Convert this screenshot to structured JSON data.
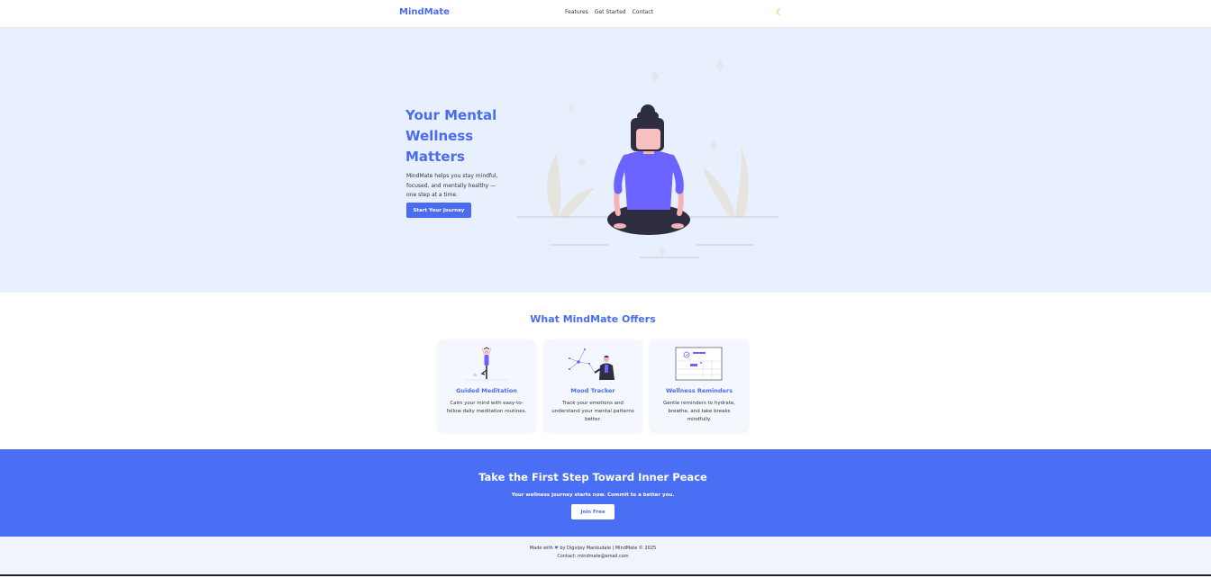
{
  "nav": {
    "logo": "MindMate",
    "links": [
      "Features",
      "Get Started",
      "Contact"
    ],
    "theme_icon": "moon-icon"
  },
  "hero": {
    "title": "Your Mental Wellness Matters",
    "text": "MindMate helps you stay mindful, focused, and mentally healthy — one step at a time.",
    "button": "Start Your Journey",
    "illustration": "meditating-woman-illustration"
  },
  "features": {
    "title": "What MindMate Offers",
    "cards": [
      {
        "title": "Guided Meditation",
        "text": "Calm your mind with easy-to-follow daily meditation routines.",
        "image": "yoga-pose-illustration"
      },
      {
        "title": "Mood Tracker",
        "text": "Track your emotions and understand your mental patterns better.",
        "image": "mood-tracker-illustration"
      },
      {
        "title": "Wellness Reminders",
        "text": "Gentle reminders to hydrate, breathe, and take breaks mindfully.",
        "image": "reminders-illustration"
      }
    ]
  },
  "cta": {
    "title": "Take the First Step Toward Inner Peace",
    "subtitle": "Your wellness journey starts now. Commit to a better you.",
    "button": "Join Free"
  },
  "footer": {
    "made_with": "Made with",
    "heart_icon": "heart-icon",
    "credit": "by Digvijay Mankudale | MindMate © 2025",
    "contact": "Contact: mindmate@email.com"
  },
  "colors": {
    "accent": "#4a6cf0",
    "hero_bg": "#e9f0fd",
    "cta_bg": "#4a6ff4",
    "footer_bg": "#eff4fd"
  }
}
